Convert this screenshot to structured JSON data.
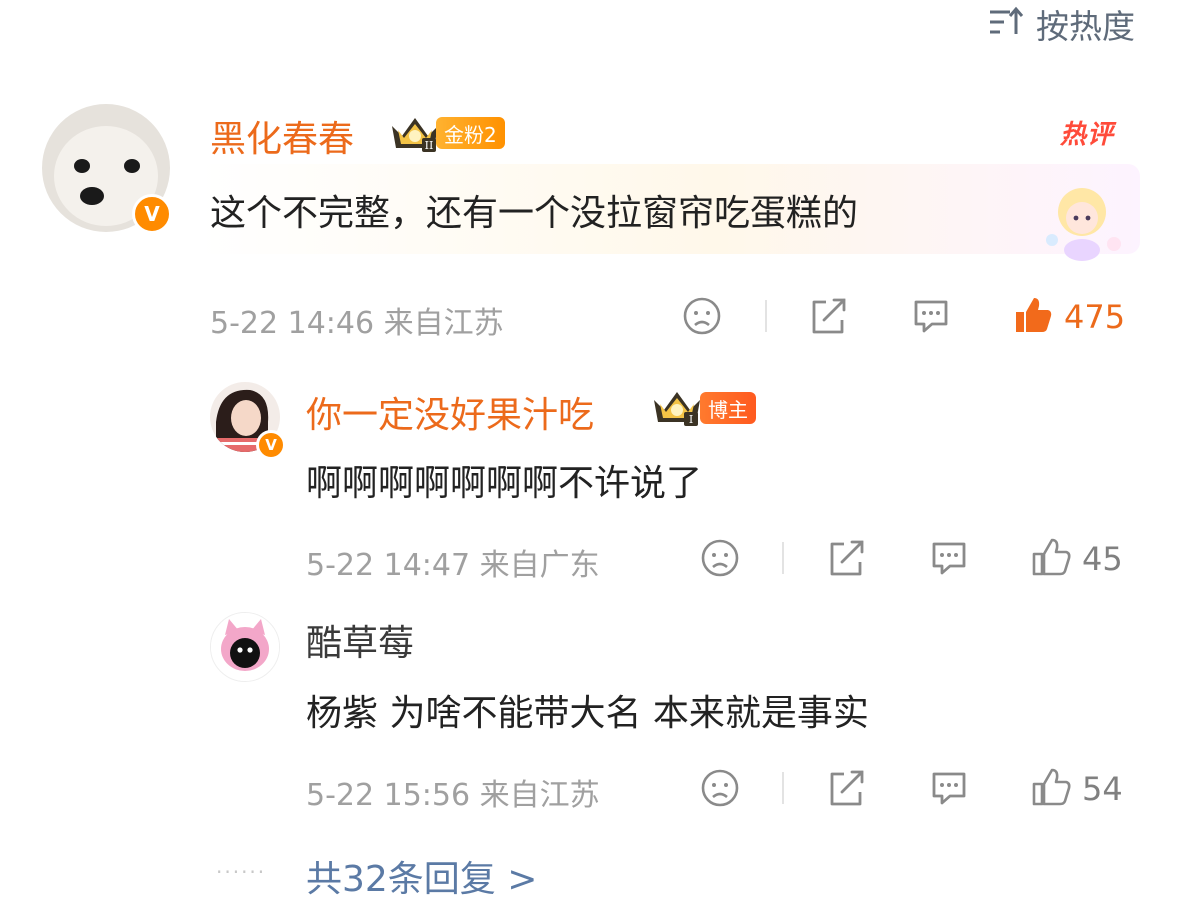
{
  "sort": {
    "label": "按热度"
  },
  "comment": {
    "username": "黑化春春",
    "fan_badge": "金粉2",
    "crown_level": "II",
    "hot_tag": "热评",
    "text": "这个不完整，还有一个没拉窗帘吃蛋糕的",
    "meta": "5-22 14:46  来自江苏",
    "likes": "475"
  },
  "replies": [
    {
      "username": "你一定没好果汁吃",
      "badge": "博主",
      "crown_level": "I",
      "text": "啊啊啊啊啊啊啊不许说了",
      "meta": "5-22 14:47  来自广东",
      "likes": "45"
    },
    {
      "username": "酷草莓",
      "text": "杨紫 为啥不能带大名 本来就是事实",
      "meta": "5-22 15:56  来自江苏",
      "likes": "54"
    }
  ],
  "more_replies": {
    "dots": "······",
    "label": "共32条回复 >"
  },
  "colors": {
    "accent": "#ec6a1b",
    "link": "#5b7aa5",
    "meta": "#a0a0a0",
    "badge": "#ff8b00"
  },
  "icons": [
    "sort-icon",
    "verified-v-icon",
    "crown-icon",
    "dislike-face-icon",
    "share-icon",
    "comment-icon",
    "like-icon"
  ]
}
